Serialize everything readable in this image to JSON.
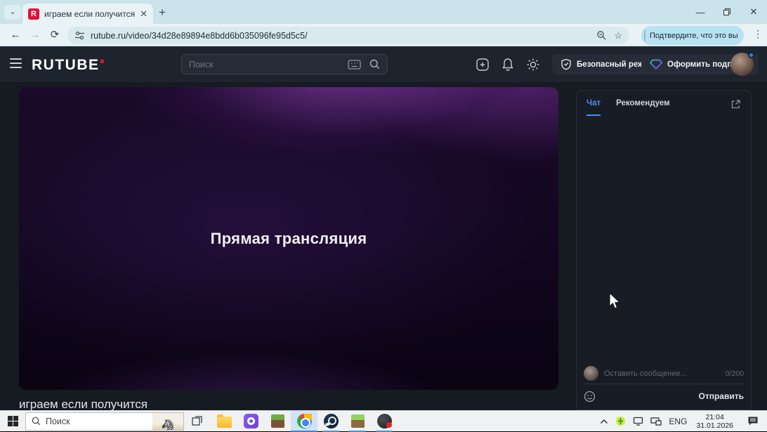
{
  "browser": {
    "tab_title": "играем если получится",
    "url": "rutube.ru/video/34d28e89894e8bdd6b035096fe95d5c5/",
    "verify_chip": "Подтвердите, что это вы"
  },
  "rutube_header": {
    "logo": "RUTUBE",
    "search_placeholder": "Поиск",
    "safe_mode_label": "Безопасный режим",
    "subscribe_label": "Оформить подписку"
  },
  "player": {
    "overlay_text": "Прямая трансляция",
    "video_title": "играем если получится"
  },
  "chat": {
    "tabs": [
      {
        "label": "Чат",
        "active": true
      },
      {
        "label": "Рекомендуем",
        "active": false
      }
    ],
    "message_placeholder": "Оставить сообщение...",
    "char_counter": "0/200",
    "send_label": "Отправить"
  },
  "taskbar": {
    "search_placeholder": "Поиск",
    "language": "ENG",
    "time": "21:04",
    "date": "31.01.2026"
  },
  "colors": {
    "accent_blue": "#4a8df6",
    "rutube_red": "#e1113a",
    "player_purple": "#3a1550"
  }
}
